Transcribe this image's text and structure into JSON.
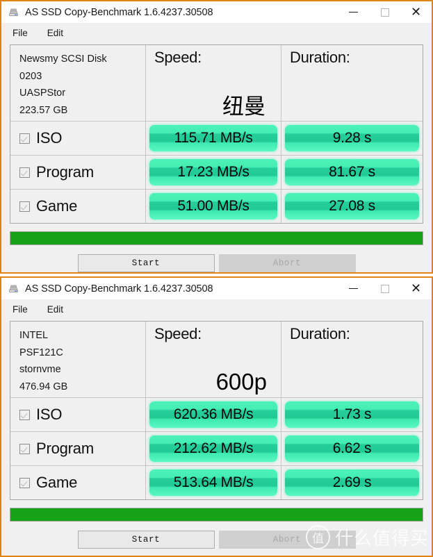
{
  "windows": [
    {
      "title": "AS SSD Copy-Benchmark 1.6.4237.30508",
      "icon": "hdd-icon",
      "menu": {
        "file": "File",
        "edit": "Edit"
      },
      "controls": {
        "minimize": "minimize-icon",
        "maximize": "maximize-icon",
        "close": "close-icon"
      },
      "drive": {
        "model": "Newsmy  SCSI Disk",
        "firmware": "0203",
        "driver": "UASPStor",
        "capacity": "223.57 GB"
      },
      "columns": {
        "speed": "Speed:",
        "duration": "Duration:"
      },
      "brand": "纽曼",
      "rows": [
        {
          "name": "ISO",
          "checked": true,
          "speed": "115.71 MB/s",
          "duration": "9.28 s"
        },
        {
          "name": "Program",
          "checked": true,
          "speed": "17.23 MB/s",
          "duration": "81.67 s"
        },
        {
          "name": "Game",
          "checked": true,
          "speed": "51.00 MB/s",
          "duration": "27.08 s"
        }
      ],
      "progress_percent": 100,
      "buttons": {
        "start": "Start",
        "abort": "Abort"
      }
    },
    {
      "title": "AS SSD Copy-Benchmark 1.6.4237.30508",
      "icon": "hdd-icon",
      "menu": {
        "file": "File",
        "edit": "Edit"
      },
      "controls": {
        "minimize": "minimize-icon",
        "maximize": "maximize-icon",
        "close": "close-icon"
      },
      "drive": {
        "model": "INTEL",
        "firmware": "PSF121C",
        "driver": "stornvme",
        "capacity": "476.94 GB"
      },
      "columns": {
        "speed": "Speed:",
        "duration": "Duration:"
      },
      "brand": "600p",
      "rows": [
        {
          "name": "ISO",
          "checked": true,
          "speed": "620.36 MB/s",
          "duration": "1.73 s"
        },
        {
          "name": "Program",
          "checked": true,
          "speed": "212.62 MB/s",
          "duration": "6.62 s"
        },
        {
          "name": "Game",
          "checked": true,
          "speed": "513.64 MB/s",
          "duration": "2.69 s"
        }
      ],
      "progress_percent": 100,
      "buttons": {
        "start": "Start",
        "abort": "Abort"
      }
    }
  ],
  "watermark": {
    "badge": "值",
    "text": "什么值得买"
  },
  "colors": {
    "window_border": "#e08214",
    "pill_green": "#2ad79f",
    "progress_green": "#16a116",
    "window_bg": "#f0f0f0"
  }
}
